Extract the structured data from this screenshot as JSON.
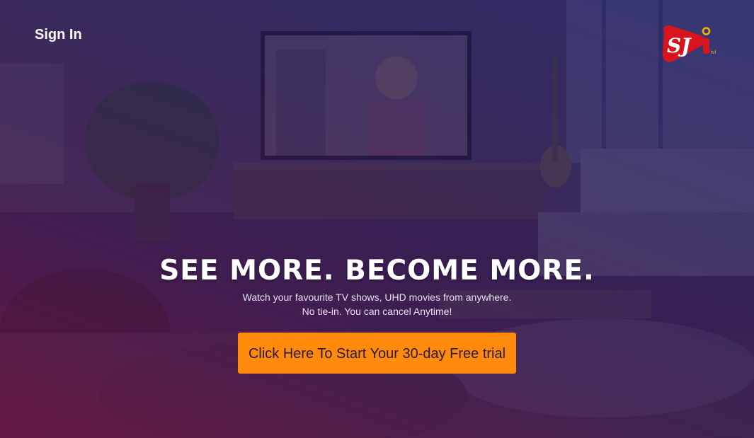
{
  "header": {
    "sign_in_label": "Sign In",
    "logo_text": "SJ"
  },
  "hero": {
    "headline": "SEE MORE. BECOME MORE.",
    "subtitle_line1": "Watch your favourite TV shows, UHD movies from anywhere.",
    "subtitle_line2": "No tie-in. You can cancel Anytime!",
    "cta_label": "Click Here To Start Your 30-day Free trial"
  },
  "colors": {
    "cta_background": "#ff8a0b",
    "logo_red": "#d8141f",
    "logo_gold": "#f2b600",
    "text_white": "#ffffff"
  }
}
